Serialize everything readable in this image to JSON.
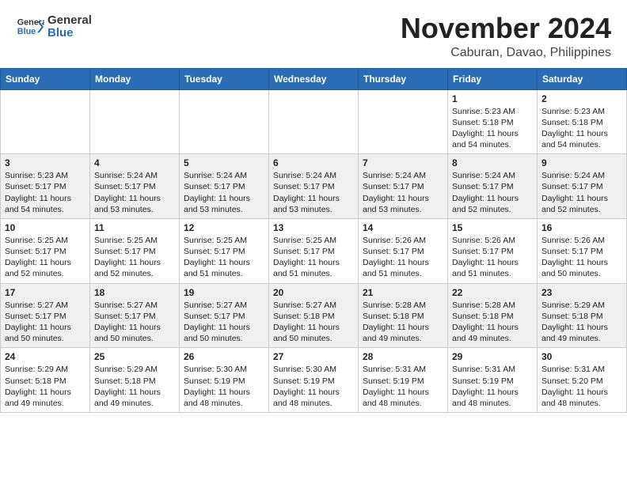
{
  "header": {
    "logo_general": "General",
    "logo_blue": "Blue",
    "month_title": "November 2024",
    "location": "Caburan, Davao, Philippines"
  },
  "calendar": {
    "days_of_week": [
      "Sunday",
      "Monday",
      "Tuesday",
      "Wednesday",
      "Thursday",
      "Friday",
      "Saturday"
    ],
    "weeks": [
      [
        {
          "day": "",
          "info": ""
        },
        {
          "day": "",
          "info": ""
        },
        {
          "day": "",
          "info": ""
        },
        {
          "day": "",
          "info": ""
        },
        {
          "day": "",
          "info": ""
        },
        {
          "day": "1",
          "info": "Sunrise: 5:23 AM\nSunset: 5:18 PM\nDaylight: 11 hours and 54 minutes."
        },
        {
          "day": "2",
          "info": "Sunrise: 5:23 AM\nSunset: 5:18 PM\nDaylight: 11 hours and 54 minutes."
        }
      ],
      [
        {
          "day": "3",
          "info": "Sunrise: 5:23 AM\nSunset: 5:17 PM\nDaylight: 11 hours and 54 minutes."
        },
        {
          "day": "4",
          "info": "Sunrise: 5:24 AM\nSunset: 5:17 PM\nDaylight: 11 hours and 53 minutes."
        },
        {
          "day": "5",
          "info": "Sunrise: 5:24 AM\nSunset: 5:17 PM\nDaylight: 11 hours and 53 minutes."
        },
        {
          "day": "6",
          "info": "Sunrise: 5:24 AM\nSunset: 5:17 PM\nDaylight: 11 hours and 53 minutes."
        },
        {
          "day": "7",
          "info": "Sunrise: 5:24 AM\nSunset: 5:17 PM\nDaylight: 11 hours and 53 minutes."
        },
        {
          "day": "8",
          "info": "Sunrise: 5:24 AM\nSunset: 5:17 PM\nDaylight: 11 hours and 52 minutes."
        },
        {
          "day": "9",
          "info": "Sunrise: 5:24 AM\nSunset: 5:17 PM\nDaylight: 11 hours and 52 minutes."
        }
      ],
      [
        {
          "day": "10",
          "info": "Sunrise: 5:25 AM\nSunset: 5:17 PM\nDaylight: 11 hours and 52 minutes."
        },
        {
          "day": "11",
          "info": "Sunrise: 5:25 AM\nSunset: 5:17 PM\nDaylight: 11 hours and 52 minutes."
        },
        {
          "day": "12",
          "info": "Sunrise: 5:25 AM\nSunset: 5:17 PM\nDaylight: 11 hours and 51 minutes."
        },
        {
          "day": "13",
          "info": "Sunrise: 5:25 AM\nSunset: 5:17 PM\nDaylight: 11 hours and 51 minutes."
        },
        {
          "day": "14",
          "info": "Sunrise: 5:26 AM\nSunset: 5:17 PM\nDaylight: 11 hours and 51 minutes."
        },
        {
          "day": "15",
          "info": "Sunrise: 5:26 AM\nSunset: 5:17 PM\nDaylight: 11 hours and 51 minutes."
        },
        {
          "day": "16",
          "info": "Sunrise: 5:26 AM\nSunset: 5:17 PM\nDaylight: 11 hours and 50 minutes."
        }
      ],
      [
        {
          "day": "17",
          "info": "Sunrise: 5:27 AM\nSunset: 5:17 PM\nDaylight: 11 hours and 50 minutes."
        },
        {
          "day": "18",
          "info": "Sunrise: 5:27 AM\nSunset: 5:17 PM\nDaylight: 11 hours and 50 minutes."
        },
        {
          "day": "19",
          "info": "Sunrise: 5:27 AM\nSunset: 5:17 PM\nDaylight: 11 hours and 50 minutes."
        },
        {
          "day": "20",
          "info": "Sunrise: 5:27 AM\nSunset: 5:18 PM\nDaylight: 11 hours and 50 minutes."
        },
        {
          "day": "21",
          "info": "Sunrise: 5:28 AM\nSunset: 5:18 PM\nDaylight: 11 hours and 49 minutes."
        },
        {
          "day": "22",
          "info": "Sunrise: 5:28 AM\nSunset: 5:18 PM\nDaylight: 11 hours and 49 minutes."
        },
        {
          "day": "23",
          "info": "Sunrise: 5:29 AM\nSunset: 5:18 PM\nDaylight: 11 hours and 49 minutes."
        }
      ],
      [
        {
          "day": "24",
          "info": "Sunrise: 5:29 AM\nSunset: 5:18 PM\nDaylight: 11 hours and 49 minutes."
        },
        {
          "day": "25",
          "info": "Sunrise: 5:29 AM\nSunset: 5:18 PM\nDaylight: 11 hours and 49 minutes."
        },
        {
          "day": "26",
          "info": "Sunrise: 5:30 AM\nSunset: 5:19 PM\nDaylight: 11 hours and 48 minutes."
        },
        {
          "day": "27",
          "info": "Sunrise: 5:30 AM\nSunset: 5:19 PM\nDaylight: 11 hours and 48 minutes."
        },
        {
          "day": "28",
          "info": "Sunrise: 5:31 AM\nSunset: 5:19 PM\nDaylight: 11 hours and 48 minutes."
        },
        {
          "day": "29",
          "info": "Sunrise: 5:31 AM\nSunset: 5:19 PM\nDaylight: 11 hours and 48 minutes."
        },
        {
          "day": "30",
          "info": "Sunrise: 5:31 AM\nSunset: 5:20 PM\nDaylight: 11 hours and 48 minutes."
        }
      ]
    ]
  }
}
